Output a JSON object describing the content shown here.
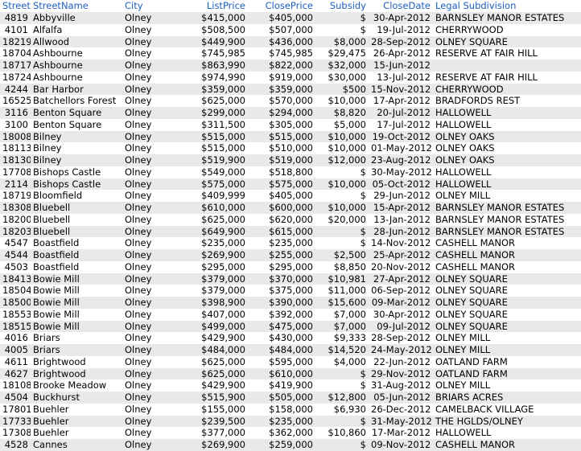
{
  "columns": [
    "StreetI",
    "StreetName",
    "City",
    "ListPrice",
    "ClosePrice",
    "Subsidy",
    "CloseDate",
    "Legal Subdivision"
  ],
  "rows": [
    [
      "4819",
      "Abbyville",
      "Olney",
      "$415,000",
      "$405,000",
      "$",
      "30-Apr-2012",
      "BARNSLEY MANOR ESTATES"
    ],
    [
      "4101",
      "Alfalfa",
      "Olney",
      "$508,500",
      "$507,000",
      "$",
      "19-Jul-2012",
      "CHERRYWOOD"
    ],
    [
      "18219",
      "Allwood",
      "Olney",
      "$449,900",
      "$436,000",
      "$8,000",
      "28-Sep-2012",
      "OLNEY SQUARE"
    ],
    [
      "18704",
      "Ashbourne",
      "Olney",
      "$745,985",
      "$745,985",
      "$29,475",
      "26-Apr-2012",
      "RESERVE AT FAIR HILL"
    ],
    [
      "18717",
      "Ashbourne",
      "Olney",
      "$863,990",
      "$822,000",
      "$32,000",
      "15-Jun-2012",
      ""
    ],
    [
      "18724",
      "Ashbourne",
      "Olney",
      "$974,990",
      "$919,000",
      "$30,000",
      "13-Jul-2012",
      "RESERVE AT FAIR HILL"
    ],
    [
      "4244",
      "Bar Harbor",
      "Olney",
      "$359,000",
      "$359,000",
      "$500",
      "15-Nov-2012",
      "CHERRYWOOD"
    ],
    [
      "16525",
      "Batchellors Forest",
      "Olney",
      "$625,000",
      "$570,000",
      "$10,000",
      "17-Apr-2012",
      "BRADFORDS REST"
    ],
    [
      "3116",
      "Benton Square",
      "Olney",
      "$299,000",
      "$294,000",
      "$8,820",
      "20-Jul-2012",
      "HALLOWELL"
    ],
    [
      "3100",
      "Benton Square",
      "Olney",
      "$311,500",
      "$305,000",
      "$5,000",
      "17-Jul-2012",
      "HALLOWELL"
    ],
    [
      "18008",
      "Bilney",
      "Olney",
      "$515,000",
      "$515,000",
      "$10,000",
      "19-Oct-2012",
      "OLNEY OAKS"
    ],
    [
      "18113",
      "Bilney",
      "Olney",
      "$515,000",
      "$510,000",
      "$10,000",
      "01-May-2012",
      "OLNEY OAKS"
    ],
    [
      "18130",
      "Bilney",
      "Olney",
      "$519,900",
      "$519,000",
      "$12,000",
      "23-Aug-2012",
      "OLNEY OAKS"
    ],
    [
      "17708",
      "Bishops Castle",
      "Olney",
      "$549,000",
      "$518,800",
      "$",
      "30-May-2012",
      "HALLOWELL"
    ],
    [
      "2114",
      "Bishops Castle",
      "Olney",
      "$575,000",
      "$575,000",
      "$10,000",
      "05-Oct-2012",
      "HALLOWELL"
    ],
    [
      "18719",
      "Bloomfield",
      "Olney",
      "$409,999",
      "$405,000",
      "$",
      "29-Jun-2012",
      "OLNEY MILL"
    ],
    [
      "18308",
      "Bluebell",
      "Olney",
      "$610,000",
      "$600,000",
      "$10,000",
      "15-Apr-2012",
      "BARNSLEY MANOR ESTATES"
    ],
    [
      "18200",
      "Bluebell",
      "Olney",
      "$625,000",
      "$620,000",
      "$20,000",
      "13-Jan-2012",
      "BARNSLEY MANOR ESTATES"
    ],
    [
      "18203",
      "Bluebell",
      "Olney",
      "$649,900",
      "$615,000",
      "$",
      "28-Jun-2012",
      "BARNSLEY MANOR ESTATES"
    ],
    [
      "4547",
      "Boastfield",
      "Olney",
      "$235,000",
      "$235,000",
      "$",
      "14-Nov-2012",
      "CASHELL MANOR"
    ],
    [
      "4544",
      "Boastfield",
      "Olney",
      "$269,900",
      "$255,000",
      "$2,500",
      "25-Apr-2012",
      "CASHELL MANOR"
    ],
    [
      "4503",
      "Boastfield",
      "Olney",
      "$295,000",
      "$295,000",
      "$8,850",
      "20-Nov-2012",
      "CASHELL MANOR"
    ],
    [
      "18413",
      "Bowie Mill",
      "Olney",
      "$379,000",
      "$370,000",
      "$10,981",
      "27-Apr-2012",
      "OLNEY SQUARE"
    ],
    [
      "18504",
      "Bowie Mill",
      "Olney",
      "$379,000",
      "$375,000",
      "$11,000",
      "06-Sep-2012",
      "OLNEY SQUARE"
    ],
    [
      "18500",
      "Bowie Mill",
      "Olney",
      "$398,900",
      "$390,000",
      "$15,600",
      "09-Mar-2012",
      "OLNEY SQUARE"
    ],
    [
      "18553",
      "Bowie Mill",
      "Olney",
      "$407,000",
      "$392,000",
      "$7,000",
      "30-Apr-2012",
      "OLNEY SQUARE"
    ],
    [
      "18515",
      "Bowie Mill",
      "Olney",
      "$499,000",
      "$475,000",
      "$7,000",
      "09-Jul-2012",
      "OLNEY SQUARE"
    ],
    [
      "4016",
      "Briars",
      "Olney",
      "$429,900",
      "$430,000",
      "$9,333",
      "28-Sep-2012",
      "OLNEY MILL"
    ],
    [
      "4005",
      "Briars",
      "Olney",
      "$484,000",
      "$484,000",
      "$14,520",
      "24-May-2012",
      "OLNEY MILL"
    ],
    [
      "4611",
      "Brightwood",
      "Olney",
      "$625,000",
      "$595,000",
      "$4,000",
      "22-Jun-2012",
      "OATLAND FARM"
    ],
    [
      "4627",
      "Brightwood",
      "Olney",
      "$625,000",
      "$610,000",
      "$",
      "29-Nov-2012",
      "OATLAND FARM"
    ],
    [
      "18108",
      "Brooke Meadow",
      "Olney",
      "$429,900",
      "$419,900",
      "$",
      "31-Aug-2012",
      "OLNEY MILL"
    ],
    [
      "4504",
      "Buckhurst",
      "Olney",
      "$515,900",
      "$505,000",
      "$12,800",
      "05-Jun-2012",
      "BRIARS ACRES"
    ],
    [
      "17801",
      "Buehler",
      "Olney",
      "$155,000",
      "$158,000",
      "$6,930",
      "26-Dec-2012",
      "CAMELBACK VILLAGE"
    ],
    [
      "17733",
      "Buehler",
      "Olney",
      "$239,500",
      "$235,000",
      "$",
      "31-May-2012",
      "THE HGLDS/OLNEY"
    ],
    [
      "17308",
      "Buehler",
      "Olney",
      "$377,000",
      "$362,000",
      "$10,860",
      "17-Mar-2012",
      "HALLOWELL"
    ],
    [
      "4528",
      "Cannes",
      "Olney",
      "$269,900",
      "$259,000",
      "$",
      "09-Nov-2012",
      "CASHELL MANOR"
    ]
  ]
}
